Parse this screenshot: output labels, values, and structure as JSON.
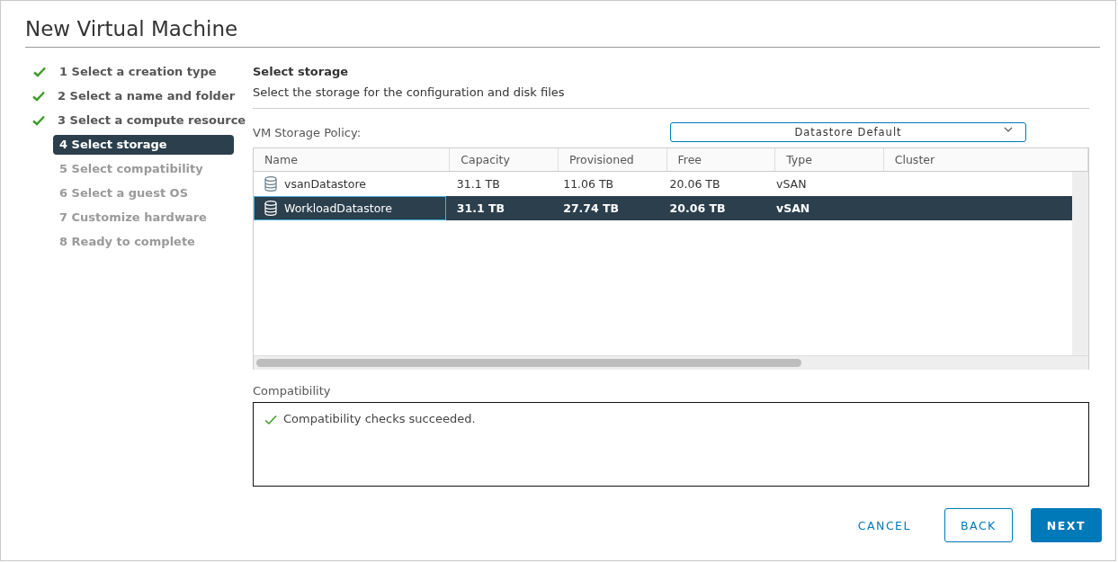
{
  "dialog": {
    "title": "New Virtual Machine"
  },
  "steps": [
    {
      "label": "1 Select a creation type",
      "completed": true,
      "selected": false,
      "disabled": false
    },
    {
      "label": "2 Select a name and folder",
      "completed": true,
      "selected": false,
      "disabled": false
    },
    {
      "label": "3 Select a compute resource",
      "completed": true,
      "selected": false,
      "disabled": false
    },
    {
      "label": "4 Select storage",
      "completed": false,
      "selected": true,
      "disabled": false
    },
    {
      "label": "5 Select compatibility",
      "completed": false,
      "selected": false,
      "disabled": true
    },
    {
      "label": "6 Select a guest OS",
      "completed": false,
      "selected": false,
      "disabled": true
    },
    {
      "label": "7 Customize hardware",
      "completed": false,
      "selected": false,
      "disabled": true
    },
    {
      "label": "8 Ready to complete",
      "completed": false,
      "selected": false,
      "disabled": true
    }
  ],
  "section": {
    "title": "Select storage",
    "description": "Select the storage for the configuration and disk files"
  },
  "policy": {
    "label": "VM Storage Policy:",
    "value": "Datastore Default"
  },
  "table": {
    "columns": [
      "Name",
      "Capacity",
      "Provisioned",
      "Free",
      "Type",
      "Cluster"
    ],
    "rows": [
      {
        "selected": false,
        "cells": [
          "vsanDatastore",
          "31.1 TB",
          "11.06 TB",
          "20.06 TB",
          "vSAN",
          ""
        ]
      },
      {
        "selected": true,
        "cells": [
          "WorkloadDatastore",
          "31.1 TB",
          "27.74 TB",
          "20.06 TB",
          "vSAN",
          ""
        ]
      }
    ]
  },
  "compatibility": {
    "label": "Compatibility",
    "message": "Compatibility checks succeeded.",
    "passed": true
  },
  "buttons": [
    {
      "label": "CANCEL",
      "kind": "flat"
    },
    {
      "label": "BACK",
      "kind": "outline"
    },
    {
      "label": "NEXT",
      "kind": "primary"
    }
  ]
}
